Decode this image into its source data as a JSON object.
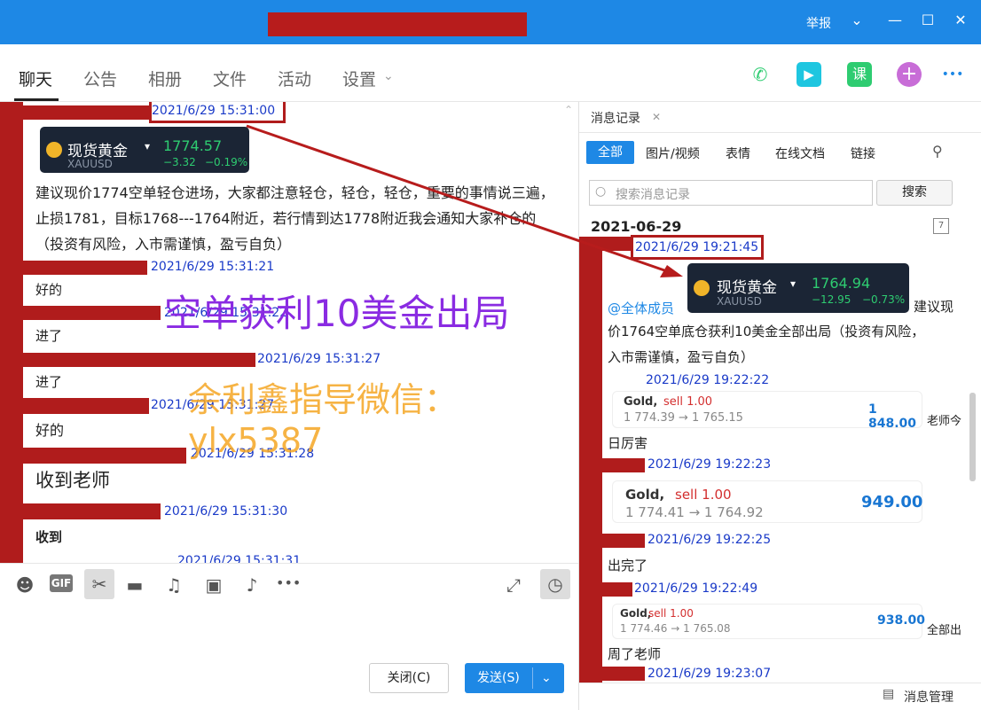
{
  "titlebar": {
    "report_label": "举报",
    "chevron": "chevron-down-icon",
    "minimize": "—",
    "maximize": "☐",
    "close": "✕"
  },
  "tabs": [
    "聊天",
    "公告",
    "相册",
    "文件",
    "活动",
    "设置"
  ],
  "tools": {
    "phone": "phone-icon",
    "video": "video-icon",
    "course_label": "课",
    "add": "+",
    "more": "•••"
  },
  "chat": {
    "messages": [
      {
        "time": "2021/6/29 15:31:00"
      },
      {
        "quote": {
          "name": "现货黄金",
          "symbol": "XAUUSD",
          "price": "1774.57",
          "change": "−3.32",
          "pct": "−0.19%"
        }
      },
      {
        "text": "建议现价1774空单轻仓进场，大家都注意轻仓，轻仓，轻仓，重要的事情说三遍，止损1781，目标1768---1764附近，若行情到达1778附近我会通知大家补仓的（投资有风险，入市需谨慎，盈亏自负）"
      },
      {
        "time": "2021/6/29 15:31:21",
        "text": "好的"
      },
      {
        "time": "2021/6/29 15:31:22",
        "text": "进了"
      },
      {
        "time": "2021/6/29 15:31:27",
        "text": "进了"
      },
      {
        "time": "2021/6/29 15:31:27",
        "text": "好的"
      },
      {
        "time": "2021/6/29 15:31:28",
        "text": "收到老师"
      },
      {
        "time": "2021/6/29 15:31:30",
        "text": "收到"
      },
      {
        "time": "2021/6/29 15:31:31"
      }
    ]
  },
  "overlay": {
    "purple_text": "空单获利10美金出局",
    "orange_text": "余利鑫指导微信：ylx5387"
  },
  "input": {
    "icons": [
      "smile-icon",
      "gif-icon",
      "scissors-icon",
      "folder-icon",
      "music-icon",
      "image-icon",
      "bell-icon",
      "more-icon"
    ],
    "gif_label": "GIF",
    "close_label": "关闭(C)",
    "send_label": "发送(S)"
  },
  "history": {
    "tab_label": "消息记录",
    "filters": [
      "全部",
      "图片/视频",
      "表情",
      "在线文档",
      "链接"
    ],
    "search_placeholder": "搜索消息记录",
    "search_button": "搜索",
    "date": "2021-06-29",
    "calendar_day": "7",
    "quote": {
      "name": "现货黄金",
      "symbol": "XAUUSD",
      "price": "1764.94",
      "change": "−12.95",
      "pct": "−0.73%"
    },
    "items": [
      {
        "time": "2021/6/29 19:21:45"
      },
      {
        "mention": "@全体成员",
        "text1": "建议现",
        "text2": "价1764空单底仓获利10美金全部出局（投资有风险，",
        "text3": "入市需谨慎，盈亏自负）"
      },
      {
        "time": "2021/6/29 19:22:22",
        "trade": {
          "g": "Gold,",
          "s": "sell 1.00",
          "r": "1 774.39 → 1 765.15",
          "a": "1 848.00"
        },
        "side": "老师今",
        "text": "日厉害"
      },
      {
        "time": "2021/6/29 19:22:23",
        "trade": {
          "g": "Gold,",
          "s": "sell 1.00",
          "r": "1 774.41 → 1 764.92",
          "a": "949.00"
        }
      },
      {
        "time": "2021/6/29 19:22:25",
        "text": "出完了"
      },
      {
        "time": "2021/6/29 19:22:49",
        "trade": {
          "g": "Gold,",
          "s": "sell 1.00",
          "r": "1 774.46 → 1 765.08",
          "a": "938.00"
        },
        "side": "全部出",
        "text": "周了老师"
      },
      {
        "time": "2021/6/29 19:23:07"
      }
    ],
    "manage_label": "消息管理"
  }
}
